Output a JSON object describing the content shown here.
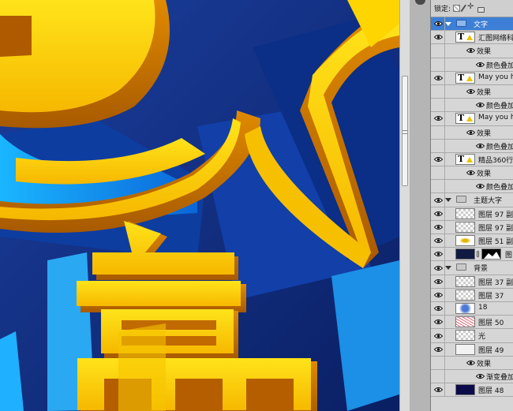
{
  "panel": {
    "lock_label": "锁定:"
  },
  "layers": [
    {
      "name": "文字",
      "kind": "group",
      "selected": true,
      "indent": 0,
      "eye": true
    },
    {
      "name": "汇图网络科",
      "kind": "text",
      "indent": 1,
      "eye": true
    },
    {
      "name": "效果",
      "kind": "effects",
      "indent": 2,
      "eye": false
    },
    {
      "name": "颜色叠加",
      "kind": "effect",
      "indent": 3,
      "eye": false
    },
    {
      "name": "May you ha",
      "kind": "text",
      "indent": 1,
      "eye": true
    },
    {
      "name": "效果",
      "kind": "effects",
      "indent": 2,
      "eye": false
    },
    {
      "name": "颜色叠加",
      "kind": "effect",
      "indent": 3,
      "eye": false
    },
    {
      "name": "May you ha",
      "kind": "text",
      "indent": 1,
      "eye": true
    },
    {
      "name": "效果",
      "kind": "effects",
      "indent": 2,
      "eye": false
    },
    {
      "name": "颜色叠加",
      "kind": "effect",
      "indent": 3,
      "eye": false
    },
    {
      "name": "精品360行",
      "kind": "text",
      "indent": 1,
      "eye": true
    },
    {
      "name": "效果",
      "kind": "effects",
      "indent": 2,
      "eye": false
    },
    {
      "name": "颜色叠加",
      "kind": "effect",
      "indent": 3,
      "eye": false
    },
    {
      "name": "主题大字",
      "kind": "group",
      "indent": 0,
      "eye": true
    },
    {
      "name": "图层 97 副",
      "kind": "layer",
      "thumb": "checker",
      "indent": 1,
      "eye": true
    },
    {
      "name": "图层 97 副",
      "kind": "layer",
      "thumb": "checker",
      "indent": 1,
      "eye": true
    },
    {
      "name": "图层 51 副",
      "kind": "layer",
      "thumb": "yel",
      "indent": 1,
      "eye": true
    },
    {
      "name": "图",
      "kind": "masked",
      "thumb": "dark",
      "indent": 1,
      "eye": true
    },
    {
      "name": "背景",
      "kind": "group",
      "indent": 0,
      "eye": true
    },
    {
      "name": "图层 37 副",
      "kind": "layer",
      "thumb": "checker",
      "indent": 1,
      "eye": true
    },
    {
      "name": "图层 37",
      "kind": "layer",
      "thumb": "checker",
      "indent": 1,
      "eye": true
    },
    {
      "name": "18",
      "kind": "layer",
      "thumb": "blue",
      "indent": 1,
      "eye": true
    },
    {
      "name": "图层 50",
      "kind": "layer",
      "thumb": "pink",
      "indent": 1,
      "eye": true
    },
    {
      "name": "光",
      "kind": "layer",
      "thumb": "checker",
      "indent": 1,
      "eye": true
    },
    {
      "name": "图层 49",
      "kind": "layer",
      "thumb": "plain",
      "indent": 1,
      "eye": true
    },
    {
      "name": "效果",
      "kind": "effects",
      "indent": 2,
      "eye": false
    },
    {
      "name": "渐变叠加",
      "kind": "effect",
      "indent": 3,
      "eye": false
    },
    {
      "name": "图层 48",
      "kind": "layer",
      "thumb": "navy",
      "indent": 1,
      "eye": true
    }
  ],
  "canvas": {
    "glyph": "赢"
  }
}
